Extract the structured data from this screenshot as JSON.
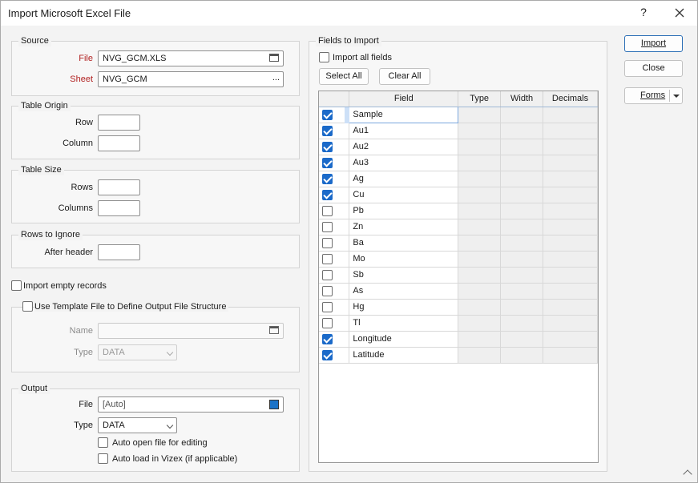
{
  "window": {
    "title": "Import Microsoft Excel File",
    "help": "?",
    "close": "✕"
  },
  "source": {
    "legend": "Source",
    "file_label": "File",
    "file_value": "NVG_GCM.XLS",
    "sheet_label": "Sheet",
    "sheet_value": "NVG_GCM",
    "browse": "..."
  },
  "table_origin": {
    "legend": "Table Origin",
    "row_label": "Row",
    "row_value": "",
    "column_label": "Column",
    "column_value": ""
  },
  "table_size": {
    "legend": "Table Size",
    "rows_label": "Rows",
    "rows_value": "",
    "columns_label": "Columns",
    "columns_value": ""
  },
  "rows_to_ignore": {
    "legend": "Rows to Ignore",
    "after_header_label": "After header",
    "after_header_value": ""
  },
  "import_empty": {
    "label": "Import empty records",
    "checked": false
  },
  "template": {
    "label": "Use Template File to Define Output File Structure",
    "checked": false,
    "name_label": "Name",
    "name_value": "",
    "type_label": "Type",
    "type_value": "DATA"
  },
  "output": {
    "legend": "Output",
    "file_label": "File",
    "file_value": "[Auto]",
    "type_label": "Type",
    "type_value": "DATA",
    "auto_open_label": "Auto open file for editing",
    "auto_load_label": "Auto load in Vizex (if applicable)"
  },
  "fields": {
    "legend": "Fields to Import",
    "import_all_label": "Import all fields",
    "select_all": "Select All",
    "clear_all": "Clear All",
    "columns": [
      "Field",
      "Type",
      "Width",
      "Decimals"
    ],
    "rows": [
      {
        "name": "Sample",
        "checked": true
      },
      {
        "name": "Au1",
        "checked": true
      },
      {
        "name": "Au2",
        "checked": true
      },
      {
        "name": "Au3",
        "checked": true
      },
      {
        "name": "Ag",
        "checked": true
      },
      {
        "name": "Cu",
        "checked": true
      },
      {
        "name": "Pb",
        "checked": false
      },
      {
        "name": "Zn",
        "checked": false
      },
      {
        "name": "Ba",
        "checked": false
      },
      {
        "name": "Mo",
        "checked": false
      },
      {
        "name": "Sb",
        "checked": false
      },
      {
        "name": "As",
        "checked": false
      },
      {
        "name": "Hg",
        "checked": false
      },
      {
        "name": "Tl",
        "checked": false
      },
      {
        "name": "Longitude",
        "checked": true
      },
      {
        "name": "Latitude",
        "checked": true
      }
    ]
  },
  "buttons": {
    "import": "Import",
    "close": "Close",
    "forms": "Forms"
  },
  "colors": {
    "accent": "#1b6ac9",
    "required_label": "#b22222"
  }
}
